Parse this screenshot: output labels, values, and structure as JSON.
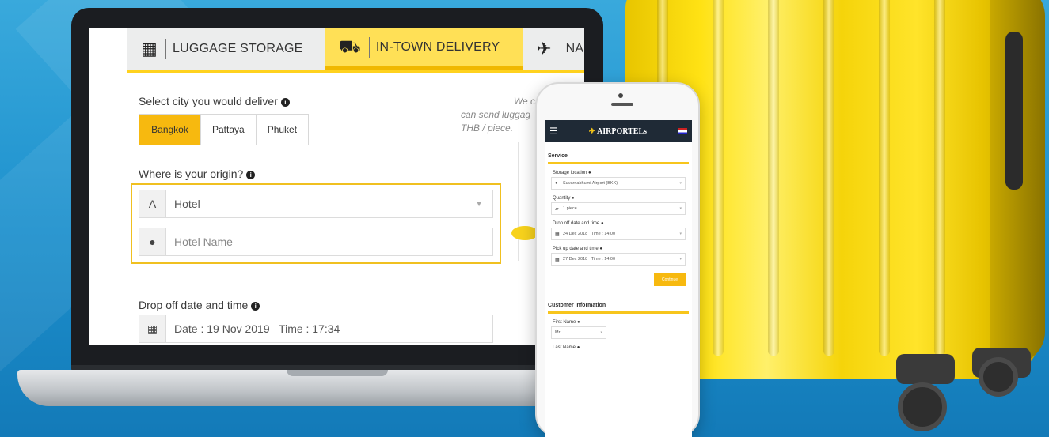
{
  "laptop": {
    "tabs": [
      {
        "label": "LUGGAGE STORAGE",
        "icon": "storage-box-icon"
      },
      {
        "label": "IN-TOWN DELIVERY",
        "icon": "hand-truck-icon"
      },
      {
        "label": "NA",
        "icon": "airplane-icon"
      }
    ],
    "city_label": "Select city you would deliver",
    "cities": [
      "Bangkok",
      "Pattaya",
      "Phuket"
    ],
    "selected_city": "Bangkok",
    "origin_label": "Where is your origin?",
    "origin_type": {
      "prefix": "A",
      "value": "Hotel"
    },
    "hotel_name_placeholder": "Hotel Name",
    "dropoff_label": "Drop off date and time",
    "dropoff_value": "Date : 19 Nov 2019   Time : 17:34",
    "note_lines": [
      "We can de",
      "can send luggag",
      "THB / piece."
    ]
  },
  "phone": {
    "brand": "AIRPORTELs",
    "service_heading": "Service",
    "fields": [
      {
        "label": "Storage location",
        "value": "Suvarnabhumi Airport (BKK)",
        "icon": "location-icon"
      },
      {
        "label": "Quantity",
        "value": "1 piece",
        "icon": "bag-icon"
      },
      {
        "label": "Drop off date and time",
        "value": "24 Dec 2018   Time : 14:00",
        "icon": "calendar-icon"
      },
      {
        "label": "Pick up date and time",
        "value": "27 Dec 2018   Time : 14:00",
        "icon": "calendar-icon"
      }
    ],
    "continue_label": "Continue",
    "customer_heading": "Customer Information",
    "first_name_label": "First Name",
    "first_name_value": "Mr.",
    "last_name_label": "Last Name"
  },
  "colors": {
    "accent": "#f7b90f",
    "tab_active": "#ffe056",
    "nav_dark": "#1f2a36",
    "background": "#1c8fcc"
  }
}
